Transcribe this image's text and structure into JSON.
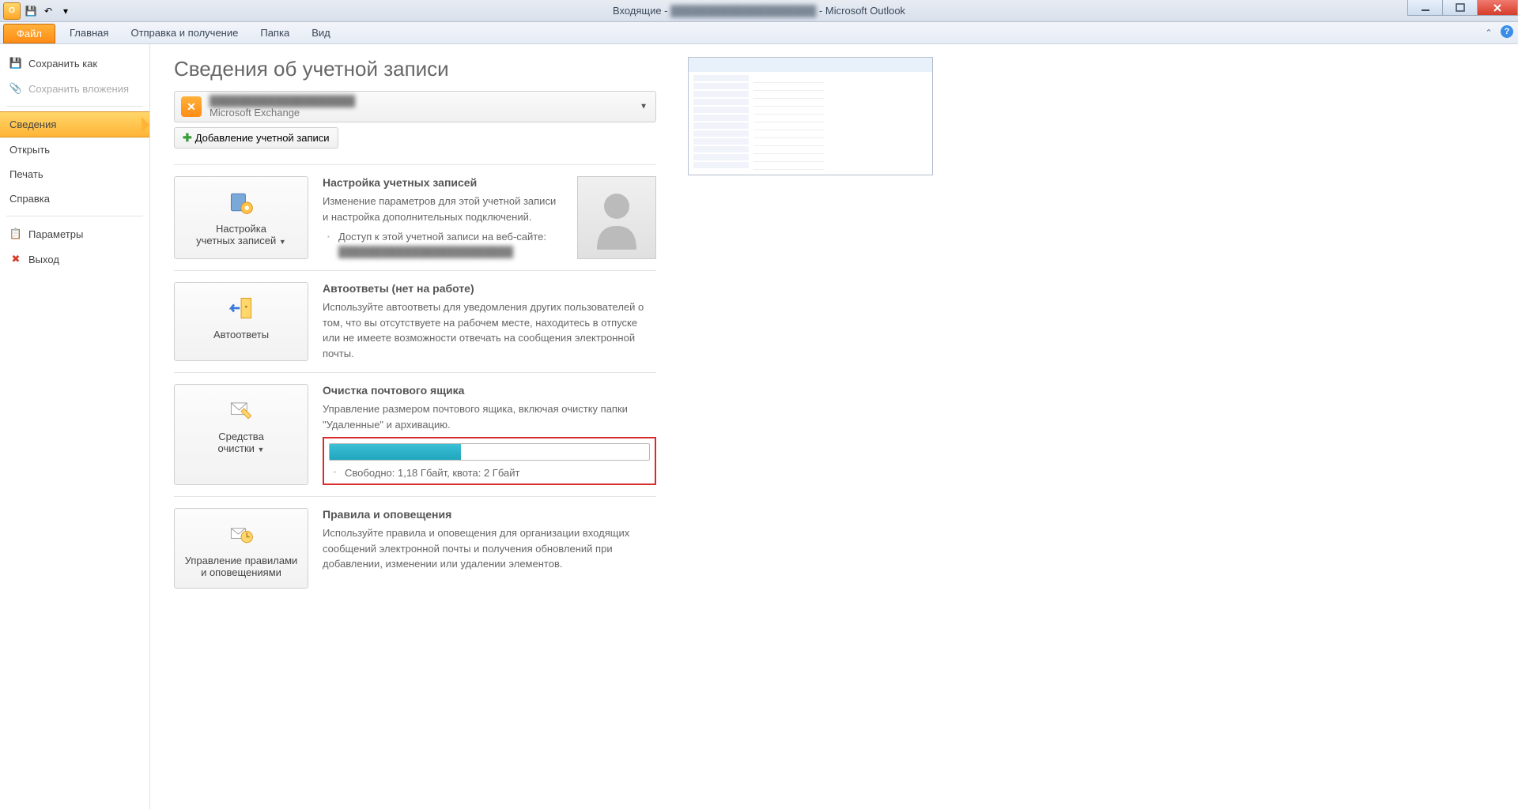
{
  "titlebar": {
    "prefix": "Входящие - ",
    "blurred_account": "████████████████████",
    "suffix": " - Microsoft Outlook"
  },
  "ribbon": {
    "file": "Файл",
    "tabs": [
      "Главная",
      "Отправка и получение",
      "Папка",
      "Вид"
    ]
  },
  "left_menu": {
    "save_as": "Сохранить как",
    "save_attachments": "Сохранить вложения",
    "info": "Сведения",
    "open": "Открыть",
    "print": "Печать",
    "help": "Справка",
    "options": "Параметры",
    "exit": "Выход"
  },
  "page": {
    "title": "Сведения об учетной записи",
    "account_email_blur": "████████████████████",
    "account_type": "Microsoft Exchange",
    "add_account": "Добавление учетной записи"
  },
  "sections": {
    "account": {
      "btn_line1": "Настройка",
      "btn_line2": "учетных записей",
      "title": "Настройка учетных записей",
      "desc": "Изменение параметров для этой учетной записи и настройка дополнительных подключений.",
      "bullet": "Доступ к этой учетной записи на веб-сайте:",
      "url_blur": "████████████████████████"
    },
    "autoreply": {
      "btn": "Автоответы",
      "title": "Автоответы (нет на работе)",
      "desc": "Используйте автоответы для уведомления других пользователей о том, что вы отсутствуете на рабочем месте, находитесь в отпуске или не имеете возможности отвечать на сообщения электронной почты."
    },
    "cleanup": {
      "btn_line1": "Средства",
      "btn_line2": "очистки",
      "title": "Очистка почтового ящика",
      "desc": "Управление размером почтового ящика, включая очистку папки \"Удаленные\" и архивацию.",
      "quota_text": "Свободно: 1,18 Гбайт, квота: 2 Гбайт",
      "quota_percent": 41
    },
    "rules": {
      "btn_line1": "Управление правилами",
      "btn_line2": "и оповещениями",
      "title": "Правила и оповещения",
      "desc": "Используйте правила и оповещения для организации входящих сообщений электронной почты и получения обновлений при добавлении, изменении или удалении элементов."
    }
  }
}
